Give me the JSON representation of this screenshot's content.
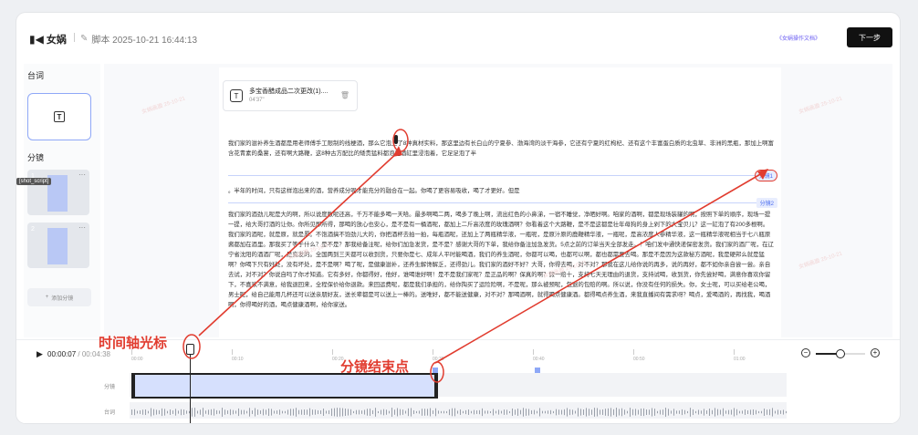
{
  "header": {
    "logo_mark": "▮◀",
    "logo_text": "女娲",
    "title": "脚本 2025-10-21 16:44:13",
    "help_link": "《女娲操作文档》",
    "next_label": "下一步"
  },
  "sidebar": {
    "lines_title": "台词",
    "shots_title": "分镜",
    "shots": [
      {
        "num": "1"
      },
      {
        "num": "2"
      }
    ],
    "add_shot_label": "添加分镜",
    "tooltip": "[shot_script]"
  },
  "file": {
    "name": "多宝香醋成品二次更改(1)....",
    "duration": "04'37\""
  },
  "script": {
    "para1": "我们家的滋补养生酒都是用老师傅手工限制的线梗酒，那么它泡上了8种真材实料，那这里边有长白山的宁夏参、渤海湾的淡干海参，它还有宁夏的红枸杞、还有这个丰富蛋白质的北虫草、非洲的黑瓶，那加上啊富含花青素的桑葚，还有啊大路鞭，这8种古方配比的矮贵猛料都泡在酒缸里浸泡着，它足足泡了半",
    "shot1_tag": "分镜1",
    "para2": "。半年的时间，只有这样泡出来的酒，营养成分呢才能充分的融合在一起。你喝了更容易吸收，喝了才更好。但是",
    "shot2_tag": "分镜2",
    "para3": "我们家的酒劲儿呢是大的啊，所以说度数呢还高，千万不能多喝一天哈。最多啊喝二两，喝多了晚上啊，流出红色的小鼻涕，一宿不睡觉，净晒好啊。咱家的酒啊，都是现场装罐的啊，按照下单的顺序，现场一提一提，给大哥打酒的让你。你所见即所得，那喝的放心也安心，是不是有一桶酒呢，都加上二斤高浓度的玫瑰酒啊？你看着这个大路鞭，是不是这都是壮年母狗的身上剁下的大宝贝儿？这一缸泡了有200多根啊。我们家的酒呢，就是原，就是厚。不饱酒搞不饱劲儿大的，你把酒杯去拍一拍，每瓶酒呢，还加上了两瓶精华液，一瓶呢，是原汁原的鹿鞭精华液，一瓶呢，是高浓度人参精华液，这一瓶精华液呢相当于七八瓶原酱都加在酒里。那我买了等于什么？是不是？那我给备注呢，给你们加急发货，是不是？感谢大哥的下单，我给你备注加急发货。5点之前的订单当天全部发走。！咱们发中通快递保密发货。我们家的酒厂呢，在辽宁省沈阳的酒酒厂呢，是直发的。全国两到三天都可以收到货，只要你是七、成年人平时能喝酒，我们的养生酒呢，你都可以喝，也都可以啊，都也都需要去喝。那是不是因为这款秘方酒呢，我是硬邦么就是猛啊？你喝下只有好处，没有坏处，是不是啊？喝了呢，是健康滋补，还养生解馋解乏，还得劲儿。我们家的酒好不好？大哥，你得去喝，对不对？那我在这儿给你说的再多，说的再好，都不如你亲自尝一尝。亲自去试，对不对？你说自吗了你才知道。它有多好，你都得好，他好，谁喝谁好啊！是不是我们家呢？是正品的啊？保真的啊？假一赔十，支持七天无理由的退货，支持试喝，收到货，你先尝好喝，满意你喜欢你留下，不喜欢不满意，给我退回来，全程保价给你退款。来回运费呢，都是我们承担的，给你掏买了运险险啊，不是呢，那么被预呢，包退的包赔的啊。所以说，你没有任何的损失。你，女士呢，可以买给老公喝，男士呢，给自己能用几杯还可以送亲朋好友，送长辈都是可以送上一棒的。送唯好，都不能送健康，对不对？那喝酒啊，就得喝点健康酒。都得喝点养生酒，来我直播间有需求呀？喝点，爱喝酒的，再找我，喝酒啊，你得喝好的酒，喝点健康酒啊，给你家送。"
  },
  "timeline": {
    "play_icon": "▶",
    "current": "00:00:07",
    "total": "/ 00:04:38",
    "ticks": [
      "00:00",
      "00:10",
      "00:20",
      "00:30",
      "00:40",
      "00:50",
      "01:00"
    ],
    "shot_track": "分镜",
    "line_track": "台词",
    "zoom_level": 0.5
  },
  "annotations": {
    "cursor_label": "时间轴光标",
    "segment_end_label": "分镜结束点"
  },
  "watermark": "女娲画面 25-10-21"
}
